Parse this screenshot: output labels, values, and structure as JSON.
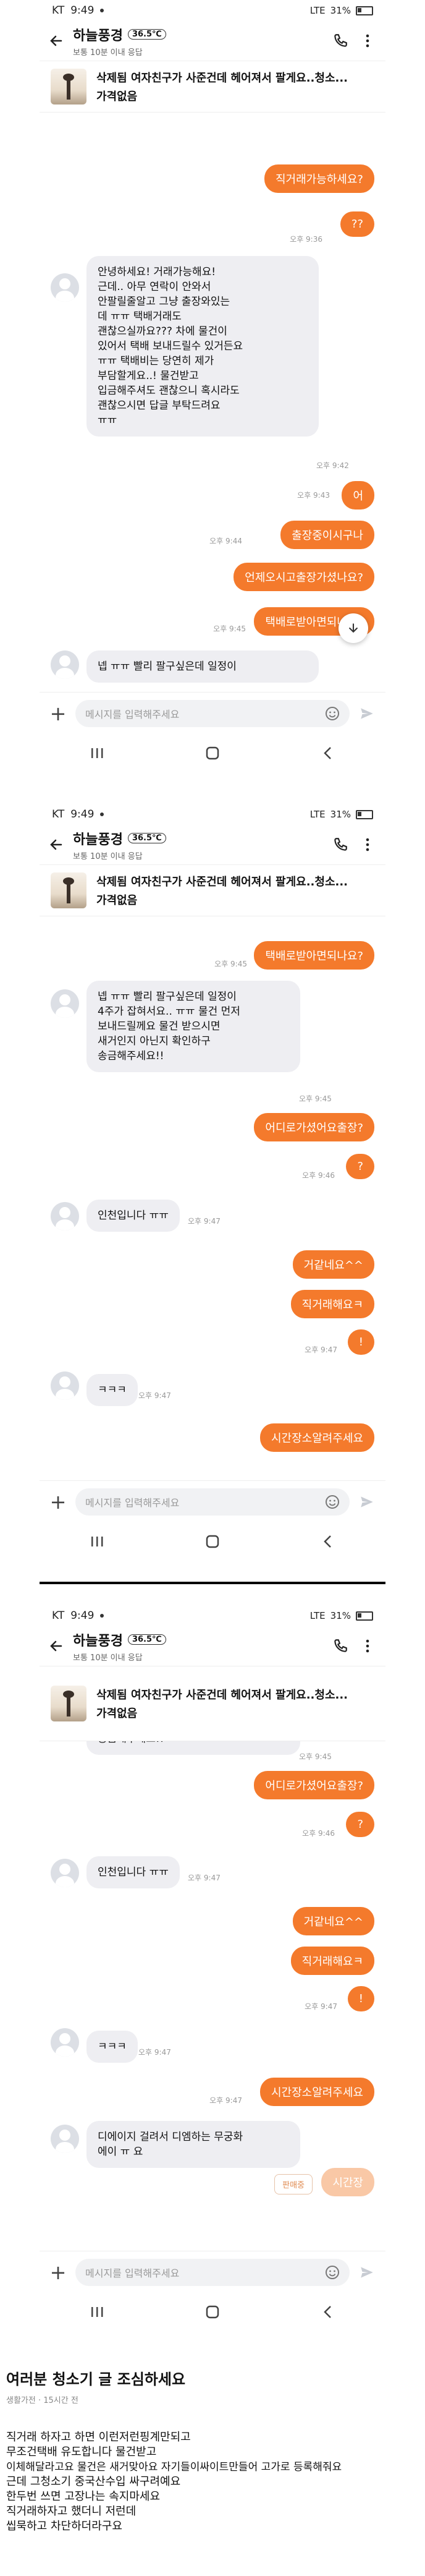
{
  "status": {
    "carrier": "KT",
    "time": "9:49",
    "network": "LTE",
    "battery": "31%"
  },
  "header": {
    "name": "하늘풍경",
    "temperature": "36.5℃",
    "subtitle": "보통 10분 이내 응답"
  },
  "product": {
    "title": "삭제됨 여자친구가 사준건데 헤어져서 팔게요..청소...",
    "price": "가격없음"
  },
  "input_placeholder": "메시지를 입력해주세요",
  "screen1": {
    "out1": "직거래가능하세요?",
    "out2": "??",
    "time_out2": "오후 9:36",
    "in1": "안녕하세요! 거래가능해요!\n근데.. 아무 연락이 안와서\n안팔릴줄알고 그냥 출장와있는\n데 ㅠㅠ 택배거래도\n괜찮으실까요??? 차에 물건이\n있어서 택배 보내드릴수 있거든요\nㅠㅠ 택배비는 당연히 제가\n부담할게요..! 물건받고\n입금해주셔도 괜찮으니 혹시라도\n괜찮으시면 답글 부탁드려요\nㅠㅠ",
    "time_in1": "오후 9:42",
    "out3": "어",
    "time_out3": "오후 9:43",
    "out4": "출장중이시구나",
    "time_out4": "오후 9:44",
    "out5": "언제오시고출장가셨나요?",
    "out6": "택배로받아면되나요?",
    "time_out6": "오후 9:45",
    "in2": "넵 ㅠㅠ 빨리 팔구싶은데 일정이"
  },
  "screen2": {
    "out1": "택배로받아면되나요?",
    "time_out1": "오후 9:45",
    "in1": "넵 ㅠㅠ 빨리 팔구싶은데 일정이\n4주가 잡혀서요.. ㅠㅠ 물건 먼저\n보내드릴께요 물건 받으시면\n새거인지 아닌지 확인하구\n송금해주세요!!",
    "time_in1": "오후 9:45",
    "out2": "어디로가셨어요출장?",
    "out3": "?",
    "time_out3": "오후 9:46",
    "in2": "인천입니다 ㅠㅠ",
    "time_in2": "오후 9:47",
    "out4": "거같네요^^",
    "out5": "직거래해요ㅋ",
    "out6": "!",
    "time_out6": "오후 9:47",
    "in3": "ㅋㅋㅋ",
    "time_in3": "오후 9:47",
    "out7": "시간장소알려주세요"
  },
  "screen3": {
    "in0": "송금해주세요!!",
    "time_in0": "오후 9:45",
    "out1": "어디로가셨어요출장?",
    "out2": "?",
    "time_out2": "오후 9:46",
    "in1": "인천입니다 ㅠㅠ",
    "time_in1": "오후 9:47",
    "out3": "거같네요^^",
    "out4": "직거래해요ㅋ",
    "out5": "!",
    "time_out5": "오후 9:47",
    "in2": "ㅋㅋㅋ",
    "time_in2": "오후 9:47",
    "out6": "시간장소알려주세요",
    "time_out6": "오후 9:47",
    "in3": "디에이지 걸려서 디엠하는 무궁화\n에이 ㅠ 요",
    "seller_chip": "판매중",
    "pending": "시간장"
  },
  "article": {
    "title": "여러분 청소기 글 조심하세요",
    "meta": "생활가전 · 15시간 전",
    "lines": [
      "직거래 하자고 하면 이런저런핑계만되고",
      "무조건택배 유도합니다 물건받고",
      "이체해달라고요 물건은 새거맞아요 자기들이싸이트만들어 고가로 등록해줘요",
      "근데 그청소기 중국산수입 싸구려예요",
      "한두번 쓰면 고장나는 속지마세요",
      "직거래하자고 했더니 저런데",
      "씹묵하고 차단하더라구요"
    ]
  }
}
